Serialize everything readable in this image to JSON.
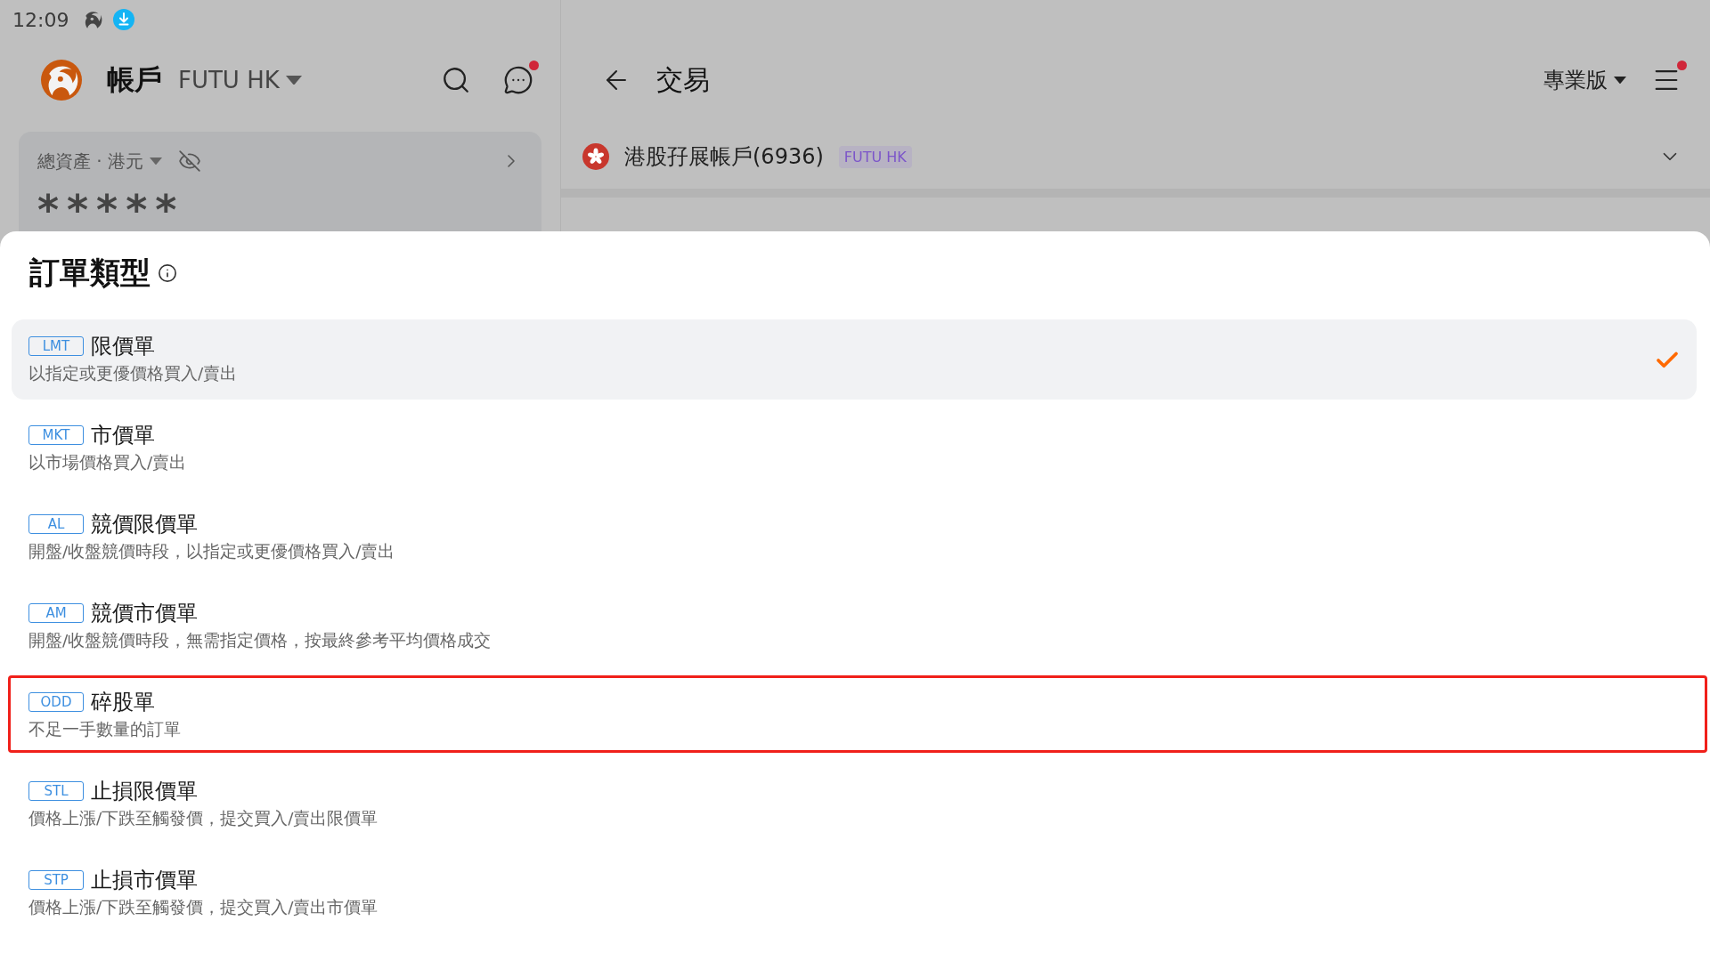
{
  "status_bar": {
    "time": "12:09"
  },
  "account_panel": {
    "title": "帳戶",
    "broker": "FUTU HK",
    "messages_unread": true,
    "assets": {
      "label": "總資產 · 港元",
      "value": "*****",
      "hidden": true
    }
  },
  "trade_panel": {
    "title": "交易",
    "mode": "專業版",
    "menu_unread": true,
    "account": {
      "name": "港股孖展帳戶(6936)",
      "badge": "FUTU HK"
    }
  },
  "order_type_sheet": {
    "title": "訂單類型",
    "items": [
      {
        "code": "LMT",
        "name": "限價單",
        "description": "以指定或更優價格買入/賣出",
        "selected": true,
        "highlighted": false
      },
      {
        "code": "MKT",
        "name": "市價單",
        "description": "以市場價格買入/賣出",
        "selected": false,
        "highlighted": false
      },
      {
        "code": "AL",
        "name": "競價限價單",
        "description": "開盤/收盤競價時段，以指定或更優價格買入/賣出",
        "selected": false,
        "highlighted": false
      },
      {
        "code": "AM",
        "name": "競價市價單",
        "description": "開盤/收盤競價時段，無需指定價格，按最終參考平均價格成交",
        "selected": false,
        "highlighted": false
      },
      {
        "code": "ODD",
        "name": "碎股單",
        "description": "不足一手數量的訂單",
        "selected": false,
        "highlighted": true
      },
      {
        "code": "STL",
        "name": "止損限價單",
        "description": "價格上漲/下跌至觸發價，提交買入/賣出限價單",
        "selected": false,
        "highlighted": false
      },
      {
        "code": "STP",
        "name": "止損市價單",
        "description": "價格上漲/下跌至觸發價，提交買入/賣出市價單",
        "selected": false,
        "highlighted": false
      }
    ]
  }
}
